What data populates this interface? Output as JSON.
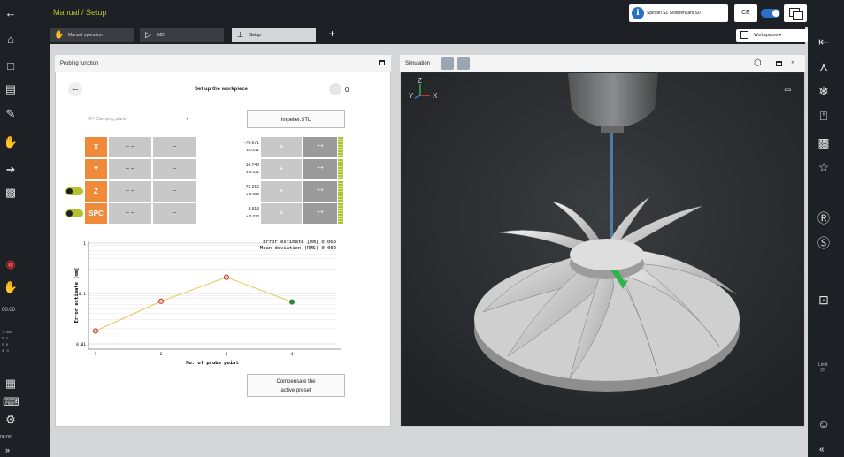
{
  "header": {
    "breadcrumb": "Manual / Setup",
    "spindle_label": "Spindel S1 Solldrehzahl S0",
    "channel": "CE"
  },
  "tabs": [
    {
      "label": "Manual operation"
    },
    {
      "label": "MDI"
    },
    {
      "label": "Setup"
    }
  ],
  "tab_add": "+",
  "workspaces_label": "Workspaces",
  "left_status": {
    "time1": "00:00",
    "time2": "08:00",
    "tfs": "T  400\nF  0\nS  0\n⊕  0"
  },
  "right_status": {
    "limit_label": "Limit\n(0)"
  },
  "probing": {
    "panel_title": "Probing function",
    "title": "Set up the workpiece",
    "counter": "0",
    "clamping_placeholder": "XY Clamping plane",
    "model_button": "Impeller.STL",
    "axes": [
      {
        "label": "X",
        "minus2": "– –",
        "minus": "–",
        "value": "-70.671",
        "tolerance": "± 0.011",
        "plus": "+",
        "plus2": "++"
      },
      {
        "label": "Y",
        "minus2": "– –",
        "minus": "–",
        "value": "16.748",
        "tolerance": "± 0.031",
        "plus": "+",
        "plus2": "++"
      },
      {
        "label": "Z",
        "minus2": "– –",
        "minus": "–",
        "value": "76.216",
        "tolerance": "± 0.009",
        "plus": "+",
        "plus2": "++"
      },
      {
        "label": "SPC",
        "minus2": "– –",
        "minus": "–",
        "value": "-8.913",
        "tolerance": "± 0.020",
        "plus": "+",
        "plus2": "++"
      }
    ],
    "compensate_line1": "Compensate the",
    "compensate_line2": "active preset"
  },
  "chart_data": {
    "type": "line",
    "x": [
      1,
      2,
      3,
      4
    ],
    "values": [
      0.018,
      0.07,
      0.21,
      0.068
    ],
    "point_colors": [
      "#c0392b",
      "#c0392b",
      "#c0392b",
      "#2e8b3e"
    ],
    "line_color": "#e8c54a",
    "xlabel": "No. of probe point",
    "ylabel": "Error estimate [mm]",
    "yscale": "log",
    "ylim": [
      0.01,
      1
    ],
    "yticks": [
      "1",
      "0.1",
      "0.01"
    ],
    "xticks": [
      "1",
      "2",
      "3",
      "4"
    ],
    "annotation_line1": "Error estimate [mm] 0.068",
    "annotation_line2": "Mean deviation (RMS) 0.002",
    "grid": true
  },
  "simulation": {
    "panel_title": "Simulation",
    "axis_y": "Y",
    "axis_z": "Z",
    "axis_x": "X"
  }
}
